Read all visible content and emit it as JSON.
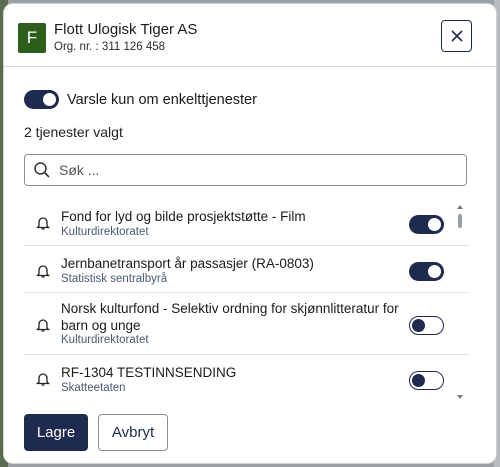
{
  "org": {
    "avatar_letter": "F",
    "name": "Flott Ulogisk Tiger AS",
    "org_nr": "Org. nr. : 311 126 458"
  },
  "dialog": {
    "close_icon": "close-icon",
    "toggle_label": "Varsle kun om enkelttjenester",
    "toggle_on": true,
    "count_text": "2 tjenester valgt",
    "search_placeholder": "Søk ...",
    "search_value": ""
  },
  "services": [
    {
      "title": "Fond for lyd og bilde prosjektstøtte - Film",
      "owner": "Kulturdirektoratet",
      "enabled": true
    },
    {
      "title": "Jernbanetransport år passasjer (RA-0803)",
      "owner": "Statistisk sentralbyrå",
      "enabled": true
    },
    {
      "title": "Norsk kulturfond - Selektiv ordning for skjønnlitteratur for barn og unge",
      "owner": "Kulturdirektoratet",
      "enabled": false
    },
    {
      "title": "RF-1304 TESTINNSENDING",
      "owner": "Skatteetaten",
      "enabled": false
    }
  ],
  "footer": {
    "save_label": "Lagre",
    "cancel_label": "Avbryt"
  },
  "colors": {
    "primary": "#1e2a4f",
    "avatar": "#2e5e1c",
    "subtext": "#4a5a74"
  }
}
